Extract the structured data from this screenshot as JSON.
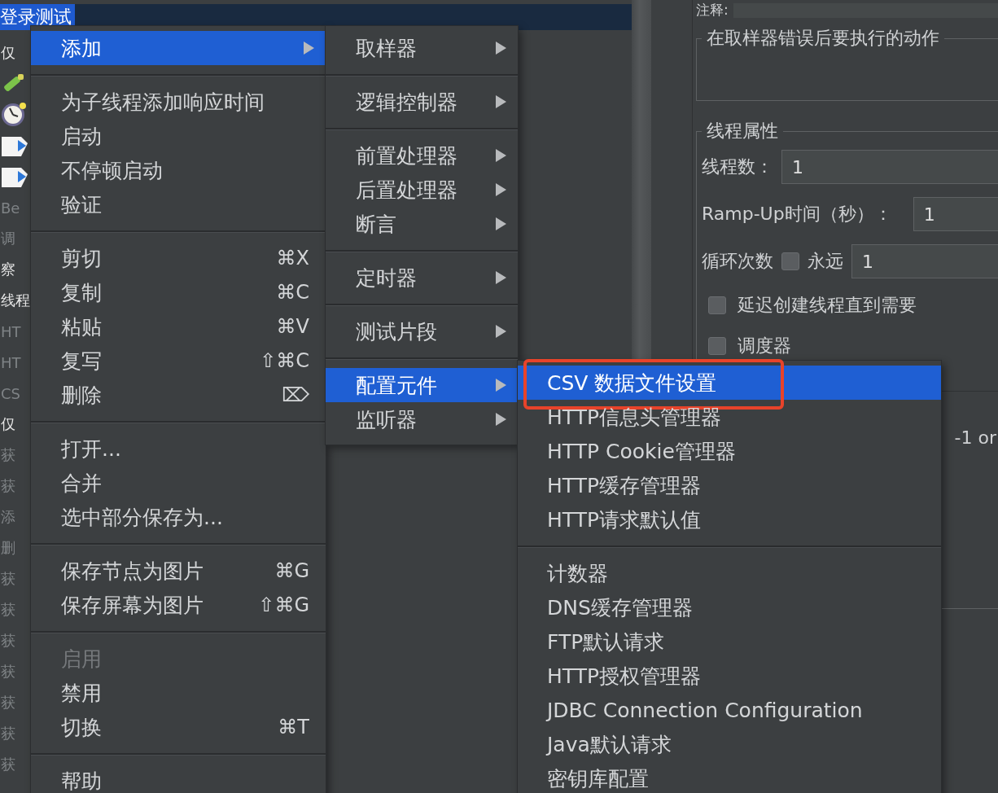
{
  "tree": {
    "title": {
      "label": "登录测试",
      "selected": true
    },
    "items": [
      {
        "kind": "text",
        "label": "仅",
        "disabled": false
      },
      {
        "kind": "pen",
        "disabled": false
      },
      {
        "kind": "clock",
        "disabled": false
      },
      {
        "kind": "doc",
        "disabled": false
      },
      {
        "kind": "doc",
        "disabled": false
      },
      {
        "kind": "text",
        "label": "Be",
        "disabled": true
      },
      {
        "kind": "text",
        "label": "调",
        "disabled": true
      },
      {
        "kind": "text",
        "label": "察",
        "disabled": false
      },
      {
        "kind": "text",
        "label": "线程",
        "disabled": false
      },
      {
        "kind": "text",
        "label": "HT",
        "disabled": true
      },
      {
        "kind": "text",
        "label": "HT",
        "disabled": true
      },
      {
        "kind": "text",
        "label": "CS",
        "disabled": true
      },
      {
        "kind": "text",
        "label": "仅",
        "disabled": false
      },
      {
        "kind": "text",
        "label": "获",
        "disabled": true
      },
      {
        "kind": "text",
        "label": "获",
        "disabled": true
      },
      {
        "kind": "text",
        "label": "添",
        "disabled": true
      },
      {
        "kind": "text",
        "label": "删",
        "disabled": true
      },
      {
        "kind": "text",
        "label": "获",
        "disabled": true
      },
      {
        "kind": "text",
        "label": "获",
        "disabled": true
      },
      {
        "kind": "text",
        "label": "获",
        "disabled": true
      },
      {
        "kind": "text",
        "label": "获",
        "disabled": true
      },
      {
        "kind": "text",
        "label": "获",
        "disabled": true
      },
      {
        "kind": "text",
        "label": "获",
        "disabled": true
      },
      {
        "kind": "text",
        "label": "获",
        "disabled": true
      }
    ]
  },
  "properties": {
    "comment_label": "注释:",
    "error_action_legend": "在取样器错误后要执行的动作",
    "thread_props": {
      "legend": "线程属性",
      "threads": {
        "label": "线程数：",
        "value": "1"
      },
      "ramp_up": {
        "label": "Ramp-Up时间（秒）：",
        "value": "1"
      },
      "loop": {
        "label": "循环次数",
        "forever_label": "永远",
        "forever_checked": false,
        "value": "1"
      },
      "delay": {
        "label": "延迟创建线程直到需要",
        "checked": false
      },
      "scheduler": {
        "label": "调度器",
        "checked": false
      }
    },
    "trailing_text": "-1 or"
  },
  "context_menu": {
    "groups": [
      [
        {
          "label": "添加",
          "submenu": true,
          "selected": true,
          "disabled": false
        }
      ],
      [
        {
          "label": "为子线程添加响应时间",
          "submenu": false,
          "selected": false,
          "disabled": false
        },
        {
          "label": "启动",
          "submenu": false,
          "selected": false,
          "disabled": false
        },
        {
          "label": "不停顿启动",
          "submenu": false,
          "selected": false,
          "disabled": false
        },
        {
          "label": "验证",
          "submenu": false,
          "selected": false,
          "disabled": false
        }
      ],
      [
        {
          "label": "剪切",
          "shortcut": "⌘X",
          "submenu": false,
          "selected": false,
          "disabled": false
        },
        {
          "label": "复制",
          "shortcut": "⌘C",
          "submenu": false,
          "selected": false,
          "disabled": false
        },
        {
          "label": "粘贴",
          "shortcut": "⌘V",
          "submenu": false,
          "selected": false,
          "disabled": false
        },
        {
          "label": "复写",
          "shortcut": "⇧⌘C",
          "submenu": false,
          "selected": false,
          "disabled": false
        },
        {
          "label": "删除",
          "shortcut": "⌦",
          "submenu": false,
          "selected": false,
          "disabled": false
        }
      ],
      [
        {
          "label": "打开...",
          "submenu": false,
          "selected": false,
          "disabled": false
        },
        {
          "label": "合并",
          "submenu": false,
          "selected": false,
          "disabled": false
        },
        {
          "label": "选中部分保存为...",
          "submenu": false,
          "selected": false,
          "disabled": false
        }
      ],
      [
        {
          "label": "保存节点为图片",
          "shortcut": "⌘G",
          "submenu": false,
          "selected": false,
          "disabled": false
        },
        {
          "label": "保存屏幕为图片",
          "shortcut": "⇧⌘G",
          "submenu": false,
          "selected": false,
          "disabled": false
        }
      ],
      [
        {
          "label": "启用",
          "submenu": false,
          "selected": false,
          "disabled": true
        },
        {
          "label": "禁用",
          "submenu": false,
          "selected": false,
          "disabled": false
        },
        {
          "label": "切换",
          "shortcut": "⌘T",
          "submenu": false,
          "selected": false,
          "disabled": false
        }
      ],
      [
        {
          "label": "帮助",
          "submenu": false,
          "selected": false,
          "disabled": false
        }
      ]
    ]
  },
  "add_menu": {
    "groups": [
      [
        {
          "label": "取样器",
          "submenu": true,
          "selected": false,
          "disabled": false
        }
      ],
      [
        {
          "label": "逻辑控制器",
          "submenu": true,
          "selected": false,
          "disabled": false
        }
      ],
      [
        {
          "label": "前置处理器",
          "submenu": true,
          "selected": false,
          "disabled": false
        },
        {
          "label": "后置处理器",
          "submenu": true,
          "selected": false,
          "disabled": false
        },
        {
          "label": "断言",
          "submenu": true,
          "selected": false,
          "disabled": false
        }
      ],
      [
        {
          "label": "定时器",
          "submenu": true,
          "selected": false,
          "disabled": false
        }
      ],
      [
        {
          "label": "测试片段",
          "submenu": true,
          "selected": false,
          "disabled": false
        }
      ],
      [
        {
          "label": "配置元件",
          "submenu": true,
          "selected": true,
          "disabled": false
        },
        {
          "label": "监听器",
          "submenu": true,
          "selected": false,
          "disabled": false
        }
      ]
    ]
  },
  "config_menu": {
    "groups": [
      [
        {
          "label": "CSV 数据文件设置",
          "submenu": false,
          "selected": true,
          "disabled": false,
          "highlighted": true
        },
        {
          "label": "HTTP信息头管理器",
          "submenu": false,
          "selected": false,
          "disabled": false,
          "highlighted": false
        },
        {
          "label": "HTTP Cookie管理器",
          "submenu": false,
          "selected": false,
          "disabled": false,
          "highlighted": false
        },
        {
          "label": "HTTP缓存管理器",
          "submenu": false,
          "selected": false,
          "disabled": false,
          "highlighted": false
        },
        {
          "label": "HTTP请求默认值",
          "submenu": false,
          "selected": false,
          "disabled": false,
          "highlighted": false
        }
      ],
      [
        {
          "label": "计数器",
          "submenu": false,
          "selected": false,
          "disabled": false,
          "highlighted": false
        },
        {
          "label": "DNS缓存管理器",
          "submenu": false,
          "selected": false,
          "disabled": false,
          "highlighted": false
        },
        {
          "label": "FTP默认请求",
          "submenu": false,
          "selected": false,
          "disabled": false,
          "highlighted": false
        },
        {
          "label": "HTTP授权管理器",
          "submenu": false,
          "selected": false,
          "disabled": false,
          "highlighted": false
        },
        {
          "label": "JDBC Connection Configuration",
          "submenu": false,
          "selected": false,
          "disabled": false,
          "highlighted": false
        },
        {
          "label": "Java默认请求",
          "submenu": false,
          "selected": false,
          "disabled": false,
          "highlighted": false
        },
        {
          "label": "密钥库配置",
          "submenu": false,
          "selected": false,
          "disabled": false,
          "highlighted": false
        }
      ]
    ]
  }
}
